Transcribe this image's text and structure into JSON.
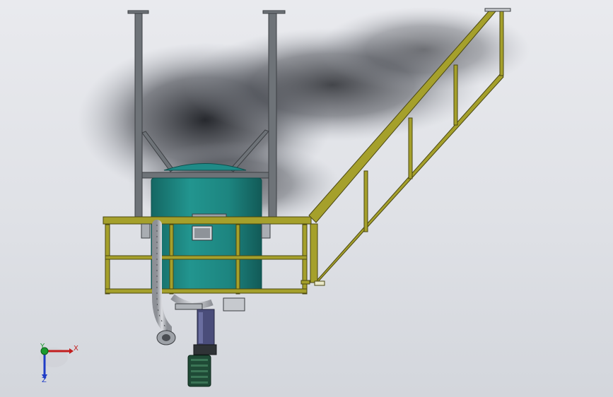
{
  "viewport": {
    "background_top": "#e9eaee",
    "background_bottom": "#d3d6dc"
  },
  "colors": {
    "steel_frame": "#6e7378",
    "steel_frame_edge": "#3c3f43",
    "handrail": "#a5a02b",
    "handrail_edge": "#4a4712",
    "vessel": "#1f8a87",
    "vessel_shadow": "#136562",
    "motor_green": "#1f4a36",
    "motor_purple": "#4a4d7a",
    "pipe_grey": "#b9bcc2",
    "axis_x": "#c21d1d",
    "axis_y": "#1a9a2e",
    "axis_z": "#1f3cc7"
  },
  "model": {
    "parts": [
      {
        "name": "support-frame",
        "icon": "steel-frame"
      },
      {
        "name": "reactor-vessel",
        "icon": "tank"
      },
      {
        "name": "platform-handrail",
        "icon": "handrail"
      },
      {
        "name": "stair-stringer",
        "icon": "stair"
      },
      {
        "name": "drive-motor",
        "icon": "motor"
      },
      {
        "name": "agitator-shaft",
        "icon": "shaft"
      },
      {
        "name": "outlet-pipe",
        "icon": "pipe"
      }
    ]
  },
  "triad": {
    "x_label": "X",
    "y_label": "Y",
    "z_label": "Z"
  }
}
